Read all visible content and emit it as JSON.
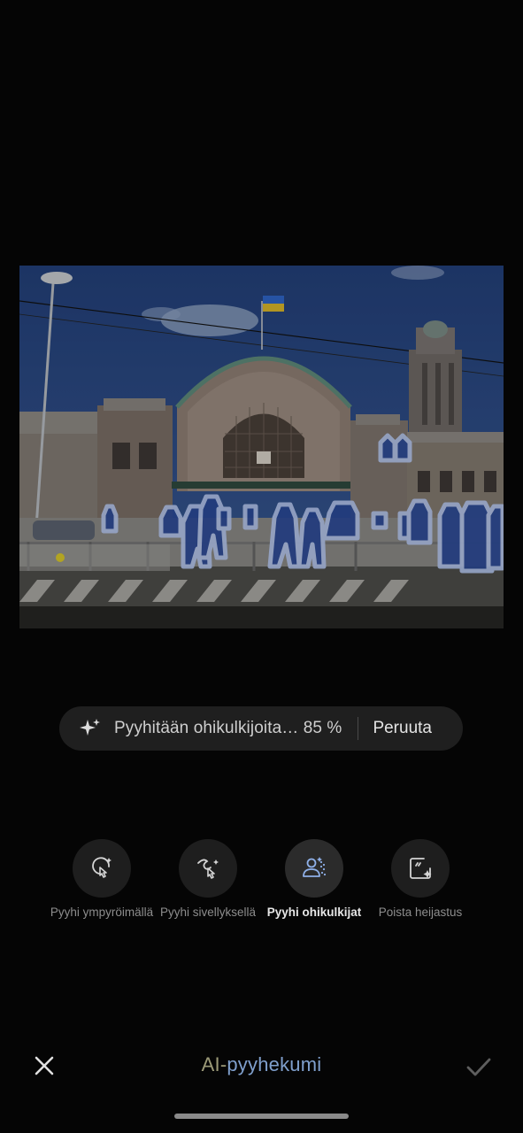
{
  "photo": {
    "alt": "Helsinki Central railway station"
  },
  "progress": {
    "text": "Pyyhitään ohikulkijoita… 85 %",
    "percent": 85,
    "cancel_label": "Peruuta"
  },
  "tools": [
    {
      "label": "Pyyhi ympyröimällä",
      "icon": "circle-select-icon",
      "active": false
    },
    {
      "label": "Pyyhi sivellyksellä",
      "icon": "brush-icon",
      "active": false
    },
    {
      "label": "Pyyhi ohikulkijat",
      "icon": "people-erase-icon",
      "active": true
    },
    {
      "label": "Poista heijastus",
      "icon": "reflection-remove-icon",
      "active": false
    }
  ],
  "bottom_bar": {
    "title_part1": "AI-",
    "title_part2": "pyyhekumi",
    "close_icon": "close-icon",
    "confirm_icon": "check-icon"
  },
  "colors": {
    "background": "#050505",
    "pill": "#1f1f1f",
    "title_gradient_start": "#9c9a78",
    "title_gradient_end": "#7f9fcc",
    "highlight": "#b6c8f0"
  }
}
